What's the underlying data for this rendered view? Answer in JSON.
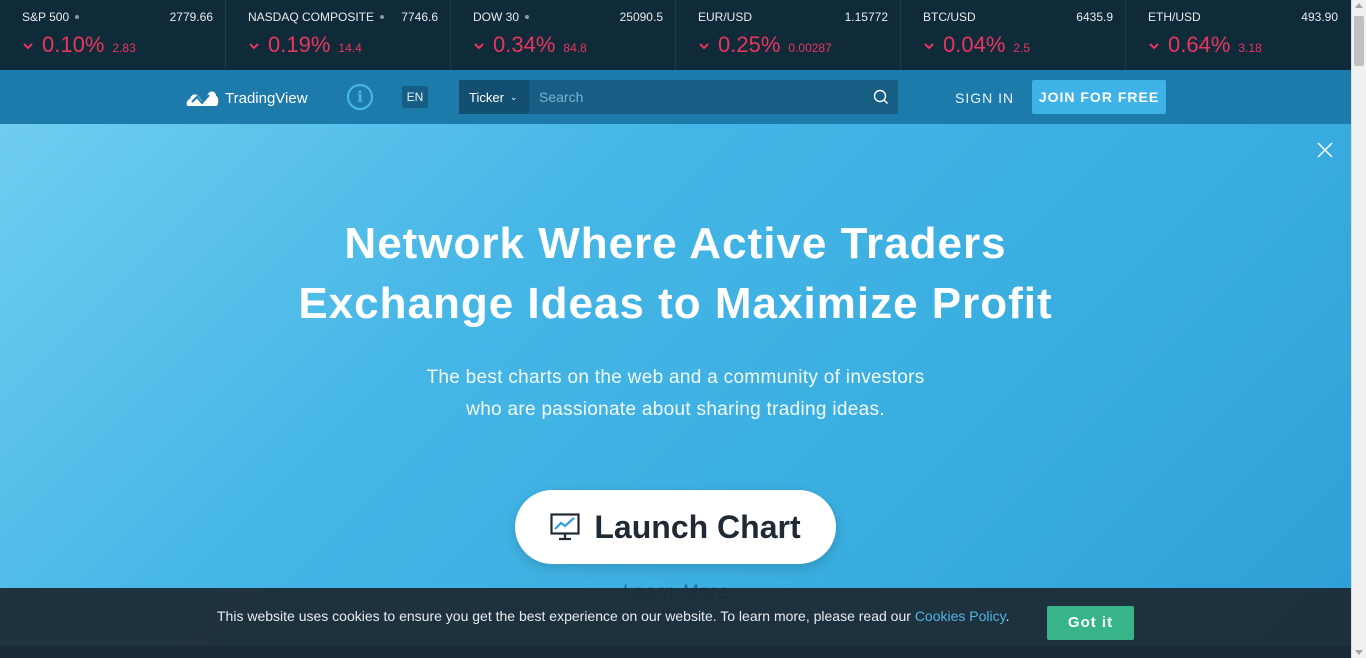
{
  "ticker": [
    {
      "name": "S&P 500",
      "has_dot": true,
      "price": "2779.66",
      "pct": "0.10%",
      "change": "2.83"
    },
    {
      "name": "NASDAQ COMPOSITE",
      "has_dot": true,
      "price": "7746.6",
      "pct": "0.19%",
      "change": "14.4"
    },
    {
      "name": "DOW 30",
      "has_dot": true,
      "price": "25090.5",
      "pct": "0.34%",
      "change": "84.8"
    },
    {
      "name": "EUR/USD",
      "has_dot": false,
      "price": "1.15772",
      "pct": "0.25%",
      "change": "0.00287"
    },
    {
      "name": "BTC/USD",
      "has_dot": false,
      "price": "6435.9",
      "pct": "0.04%",
      "change": "2.5"
    },
    {
      "name": "ETH/USD",
      "has_dot": false,
      "price": "493.90",
      "pct": "0.64%",
      "change": "3.18"
    }
  ],
  "nav": {
    "brand": "TradingView",
    "info_icon": "info-icon",
    "lang": "EN",
    "ticker_select": "Ticker",
    "search_placeholder": "Search",
    "sign_in": "SIGN IN",
    "join": "JOIN FOR FREE"
  },
  "hero": {
    "headline_line1": "Network Where Active Traders",
    "headline_line2": "Exchange Ideas to Maximize Profit",
    "sub_line1": "The best charts on the web and a community of investors",
    "sub_line2": "who are passionate about sharing trading ideas.",
    "launch": "Launch Chart",
    "learn_more": "Learn More"
  },
  "cookie": {
    "text": "This website uses cookies to ensure you get the best experience on our website. To learn more, please read our ",
    "link": "Cookies Policy",
    "suffix": ".",
    "button": "Got it"
  },
  "colors": {
    "ticker_bg": "#0f2a38",
    "down": "#e8365d",
    "nav_bg": "#1c7bab",
    "join_bg": "#3fb2e8",
    "hero_bg": "#3aaee0",
    "got_it": "#38b48b"
  }
}
